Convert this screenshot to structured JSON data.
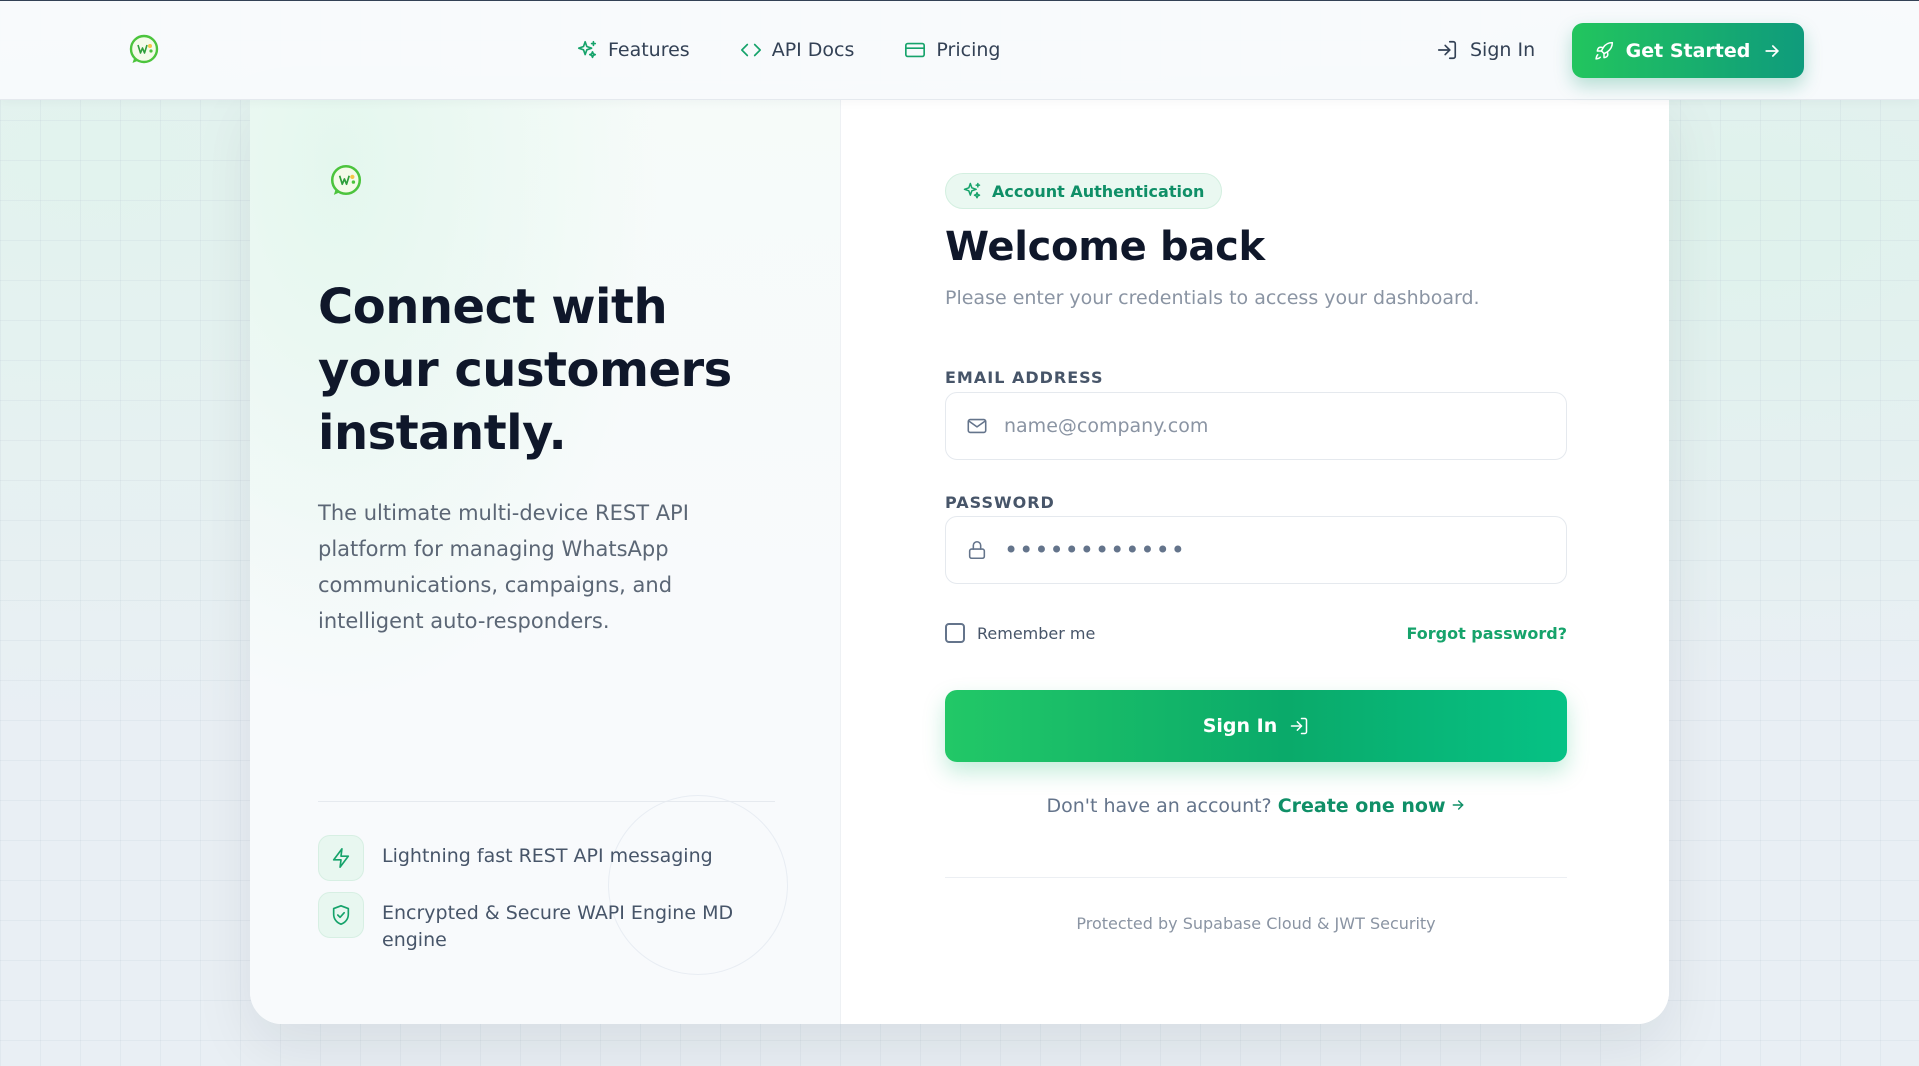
{
  "nav": {
    "links": [
      {
        "label": "Features",
        "icon": "sparkles-icon"
      },
      {
        "label": "API Docs",
        "icon": "code-icon"
      },
      {
        "label": "Pricing",
        "icon": "credit-card-icon"
      }
    ],
    "sign_in_label": "Sign In",
    "get_started_label": "Get Started"
  },
  "hero": {
    "title": "Connect with your customers instantly.",
    "description": "The ultimate multi-device REST API platform for managing WhatsApp communications, campaigns, and intelligent auto-responders.",
    "features": [
      {
        "icon": "lightning-icon",
        "text": "Lightning fast REST API messaging"
      },
      {
        "icon": "shield-check-icon",
        "text": "Encrypted & Secure WAPI Engine MD engine"
      }
    ]
  },
  "auth": {
    "badge": "Account Authentication",
    "title": "Welcome back",
    "subtitle": "Please enter your credentials to access your dashboard.",
    "email_label": "EMAIL ADDRESS",
    "email_placeholder": "name@company.com",
    "password_label": "PASSWORD",
    "password_value": "••••••••••••",
    "remember_label": "Remember me",
    "forgot_label": "Forgot password?",
    "submit_label": "Sign In",
    "signup_prompt": "Don't have an account?",
    "signup_link": "Create one now",
    "footer": "Protected by Supabase Cloud & JWT Security"
  },
  "colors": {
    "brand_green": "#16a36b",
    "brand_teal": "#0f9b7c",
    "text_dark": "#0f172a",
    "text_muted": "#8a94a3"
  }
}
